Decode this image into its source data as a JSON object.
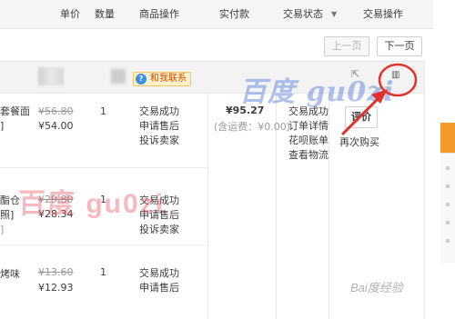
{
  "table_header": {
    "columns": [
      "单价",
      "数量",
      "商品操作",
      "实付款",
      "交易状态",
      "交易操作"
    ],
    "status_filter_arrow": "▼"
  },
  "pager": {
    "prev_label": "上一页",
    "next_label": "下一页"
  },
  "order": {
    "contact_label": "和我联系",
    "total": "¥95.27",
    "shipping": "(含运费：¥0.00)",
    "status_links": [
      "交易成功",
      "订单详情",
      "花呗账单",
      "查看物流"
    ],
    "evaluate_label": "评价",
    "rebuy_label": "再次购买",
    "items": [
      {
        "title_fragment_1": "套餐面",
        "title_fragment_2": "]",
        "original_price": "¥56.80",
        "price": "¥54.00",
        "quantity": "1",
        "ops": [
          "交易成功",
          "申请售后",
          "投诉卖家"
        ]
      },
      {
        "title_fragment_1": "酯仓",
        "title_fragment_2": "照]",
        "title_fragment_3": "]",
        "original_price": "¥29.80",
        "price": "¥28.34",
        "quantity": "1",
        "ops": [
          "交易成功",
          "申请售后",
          "投诉卖家"
        ]
      },
      {
        "title_fragment_1": "烤味",
        "original_price": "¥13.60",
        "price": "¥12.93",
        "quantity": "1",
        "ops": [
          "交易成功",
          "申请售后"
        ]
      }
    ]
  },
  "watermarks": {
    "red": "百度 gu0zi",
    "blue": "百度 gu0zi",
    "baidu": "Bai度经验"
  },
  "annotation": {
    "circle_color": "#e0322b",
    "arrow_color": "#e0322b"
  }
}
